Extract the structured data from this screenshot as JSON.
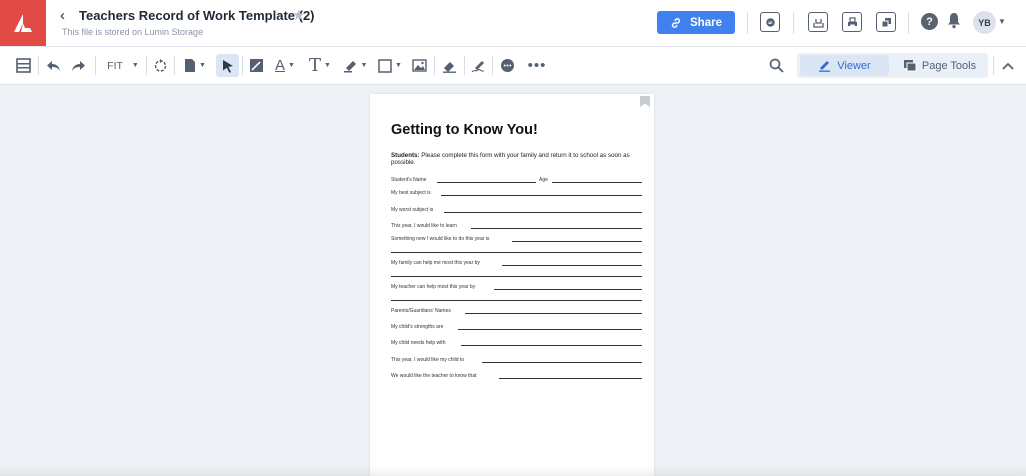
{
  "header": {
    "document_title": "Teachers Record of Work Template (2)",
    "storage_note": "This file is stored on Lumin Storage",
    "share_label": "Share",
    "avatar_initials": "YB",
    "brand_color": "#e24a45",
    "accent_color": "#3f82ef"
  },
  "toolbar": {
    "zoom_label": "FIT",
    "viewer_label": "Viewer",
    "page_tools_label": "Page Tools",
    "icons": [
      "thumbnails-icon",
      "undo-icon",
      "redo-icon",
      "rotate-icon",
      "page-icon",
      "select-arrow-icon",
      "freehand-icon",
      "text-color-icon",
      "text-tool-icon",
      "highlighter-icon",
      "shape-rectangle-icon",
      "image-icon",
      "eraser-icon",
      "signature-icon",
      "comment-icon",
      "more-icon",
      "search-icon",
      "collapse-icon"
    ]
  },
  "document": {
    "title": "Getting to Know You!",
    "intro_bold": "Students:",
    "intro_text": " Please complete this form with your family and return it to school as soon as possible.",
    "fields": {
      "student_name": "Student's Name",
      "age": "Age",
      "best_subject": "My best subject is",
      "worst_subject": "My worst subject is",
      "like_to_learn": "This year, I would like to learn",
      "something_new": "Something new I would like to do this year is",
      "family_help": "My family can help me most this year by",
      "teacher_help": "My teacher can help most this year by",
      "guardians": "Parents/Guardians' Names",
      "strengths": "My child's strengths are",
      "needs_help": "My child needs help with",
      "child_to": "This year, I would like my child to",
      "teacher_know": "We would like the teacher to know that"
    }
  }
}
